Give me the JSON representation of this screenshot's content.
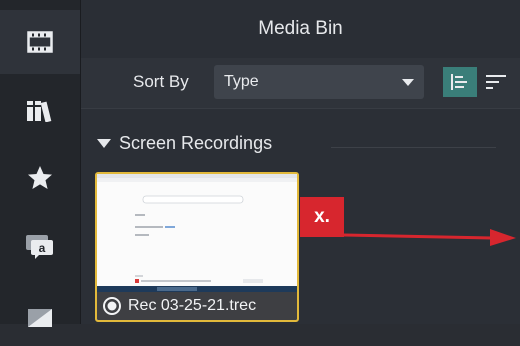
{
  "sidebar": {
    "items": [
      {
        "icon": "film-strip-icon",
        "active": true
      },
      {
        "icon": "library-icon",
        "active": false
      },
      {
        "icon": "star-icon",
        "active": false
      },
      {
        "icon": "annotation-icon",
        "active": false
      },
      {
        "icon": "transition-icon",
        "active": false
      }
    ]
  },
  "header": {
    "title": "Media Bin"
  },
  "toolbar": {
    "sort_label": "Sort By",
    "sort_value": "Type",
    "view_buttons": [
      {
        "icon": "align-left-list-icon",
        "active": true
      },
      {
        "icon": "sort-lines-icon",
        "active": false
      }
    ]
  },
  "section": {
    "label": "Screen Recordings",
    "expanded": true
  },
  "media": {
    "items": [
      {
        "name": "Rec 03-25-21.trec",
        "selected": true
      }
    ]
  },
  "annotation": {
    "label": "x.",
    "color": "#d7262e"
  },
  "colors": {
    "accent": "#3a7e79",
    "selection": "#e2b93b"
  }
}
